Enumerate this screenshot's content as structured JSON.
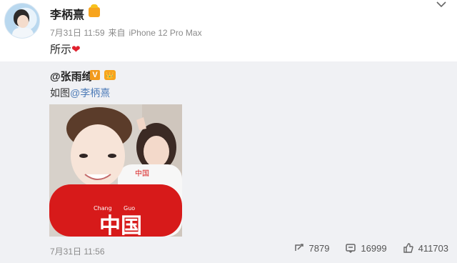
{
  "post": {
    "author": "李柄熹",
    "time": "7月31日 11:59",
    "source_prefix": "来自",
    "device": "iPhone 12 Pro Max",
    "text": "所示",
    "heart": "❤"
  },
  "repost": {
    "author": "@张雨绮",
    "v_badge": "V",
    "text_prefix": "如图",
    "mention": "@李柄熹",
    "time": "7月31日 11:56",
    "actions": {
      "share": "7879",
      "comment": "16999",
      "like": "411703"
    }
  },
  "photo": {
    "shirt_text_left": "Chang",
    "shirt_text_right": "Guo",
    "shirt_text_main": "中国",
    "woman_shirt_text": "中国"
  },
  "icons": {
    "menu": "chevron-down-icon",
    "share": "repost-icon",
    "comment": "comment-icon",
    "like": "thumbs-up-icon",
    "vip": "vip-crown-icon",
    "verified": "verified-v-icon"
  },
  "colors": {
    "mention": "#4d7bb7",
    "badge": "#f7a41d",
    "heart": "#e0202d",
    "repost_bg": "#f0f1f4"
  }
}
